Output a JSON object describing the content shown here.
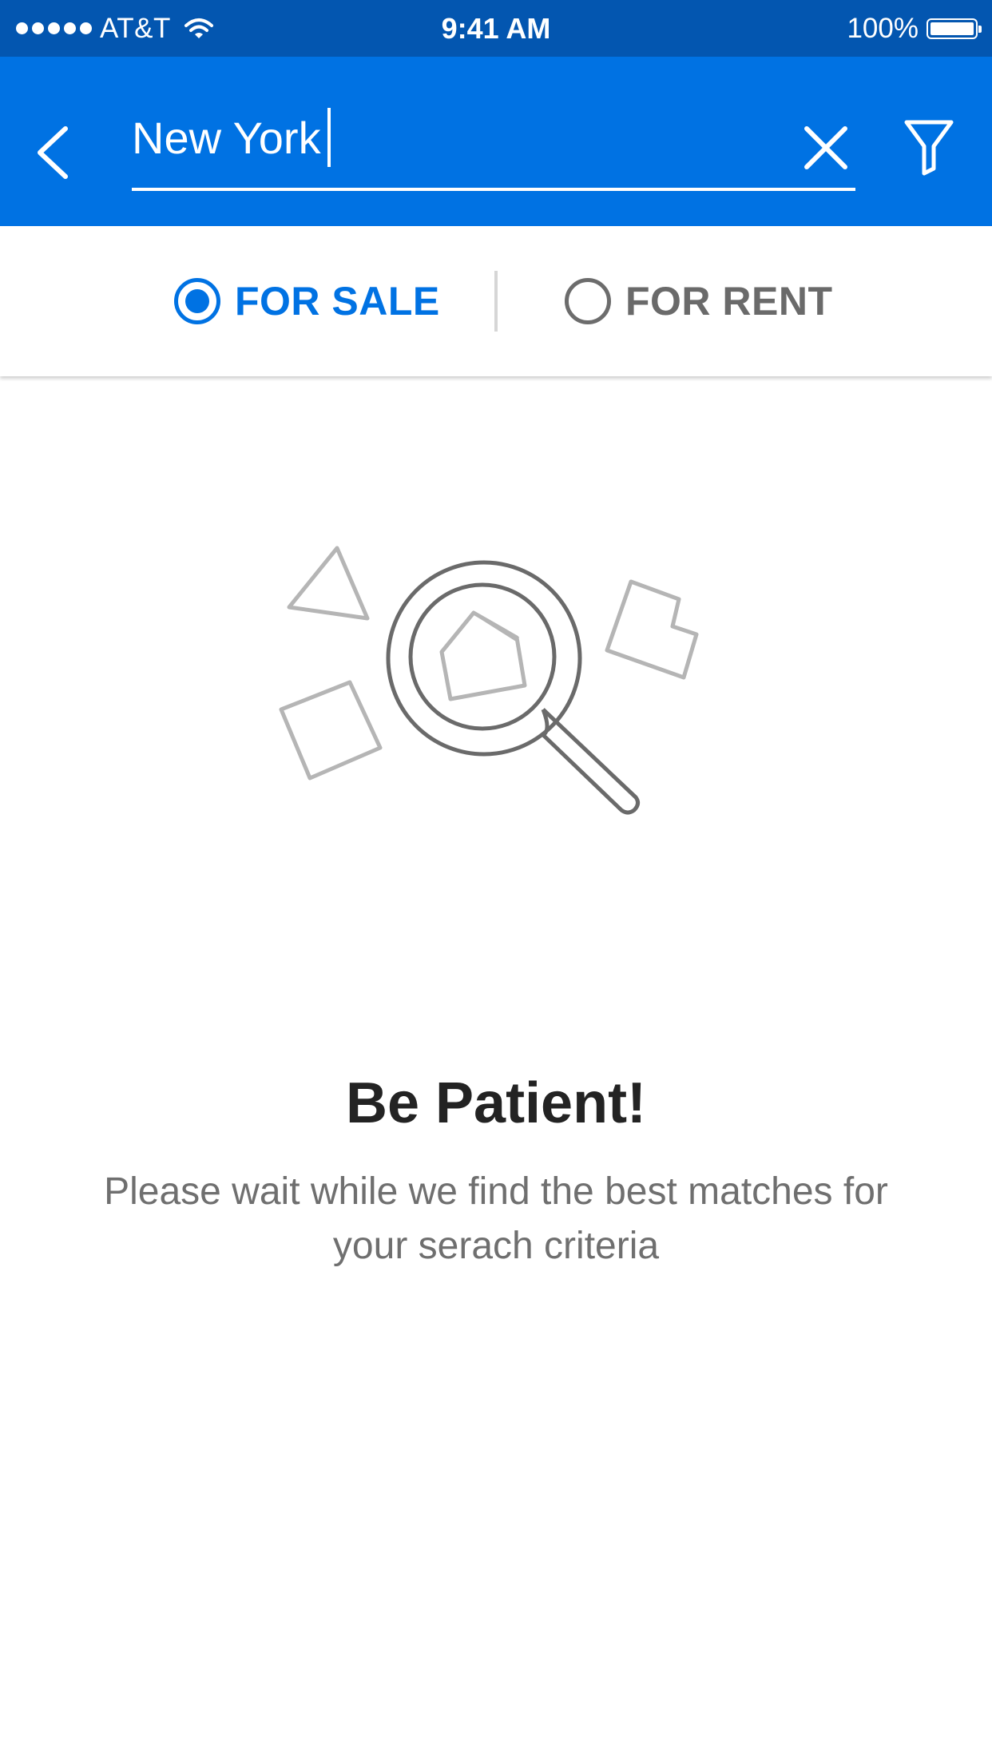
{
  "status_bar": {
    "carrier": "AT&T",
    "time": "9:41 AM",
    "battery": "100%"
  },
  "search": {
    "value": "New York",
    "icons": [
      "back-arrow-icon",
      "close-icon",
      "filter-icon"
    ]
  },
  "listing_type": {
    "options": [
      {
        "label": "FOR SALE",
        "selected": true
      },
      {
        "label": "FOR RENT",
        "selected": false
      }
    ]
  },
  "message": {
    "title": "Be Patient!",
    "body": "Please wait while we find the best matches for your serach criteria"
  },
  "colors": {
    "status_bar": "#0356b0",
    "header": "#0072e3",
    "accent": "#0072e3",
    "inactive": "#6a6a6a",
    "title": "#232323"
  }
}
